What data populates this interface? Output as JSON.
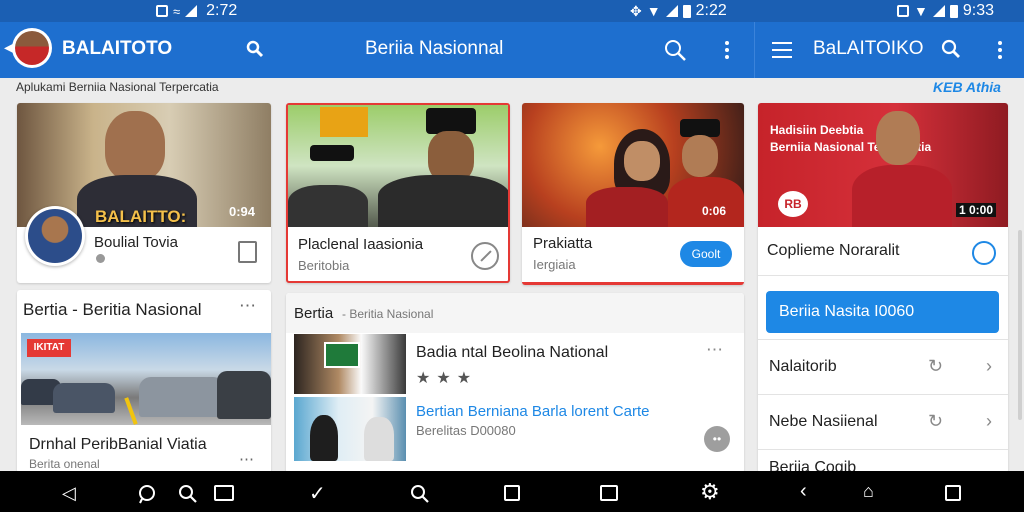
{
  "status_bar": {
    "time_left": "2:72",
    "time_mid": "2:22",
    "time_right": "9:33"
  },
  "app_bar": {
    "title_left": "BALAITOTO",
    "title_center": "Beriia Nasionnal",
    "title_right": "BaLAITOIKO",
    "color": "#1e6fcf"
  },
  "subtitle": "Aplukami Berniia Nasional Terpercatia",
  "right_brand": "KEB Athia",
  "hero": {
    "logo_text": "BALAITTO:",
    "time_badge": "0:94",
    "name": "Boulial Tovia"
  },
  "card_politics": {
    "title": "Placlenal Iaasionia",
    "sub": "Beritobia"
  },
  "card_prakiatta": {
    "title": "Prakiatta",
    "sub": "Iergiaia",
    "time_badge": "0:06",
    "button": "Goolt"
  },
  "right_panel": {
    "video_text_1": "Hadisiin Deebtia",
    "video_text_2": "Berniia Nasional Terpercatia",
    "video_badge": "RB",
    "time_badge": "1 0:00",
    "row1": "Coplieme Noraralit",
    "cta_button": "Beriia Nasita I0060",
    "row2": "Nalaitorib",
    "row3": "Nebe Nasiienal",
    "row4": "Beriia Cogib"
  },
  "section_left": {
    "title": "Bertia - Beritia Nasional",
    "badge": "IKITAT",
    "caption": "Drnhal PeribBanial Viatia",
    "caption_sub": "Berita onenal"
  },
  "section_middle": {
    "title": "Bertia",
    "subtitle": "- Beritia Nasional",
    "item1_title": "Badia ntal  Beolina National",
    "item2_title": "Bertian Berniana Barla lorent Carte",
    "item2_sub": "Berelitas D00080"
  }
}
